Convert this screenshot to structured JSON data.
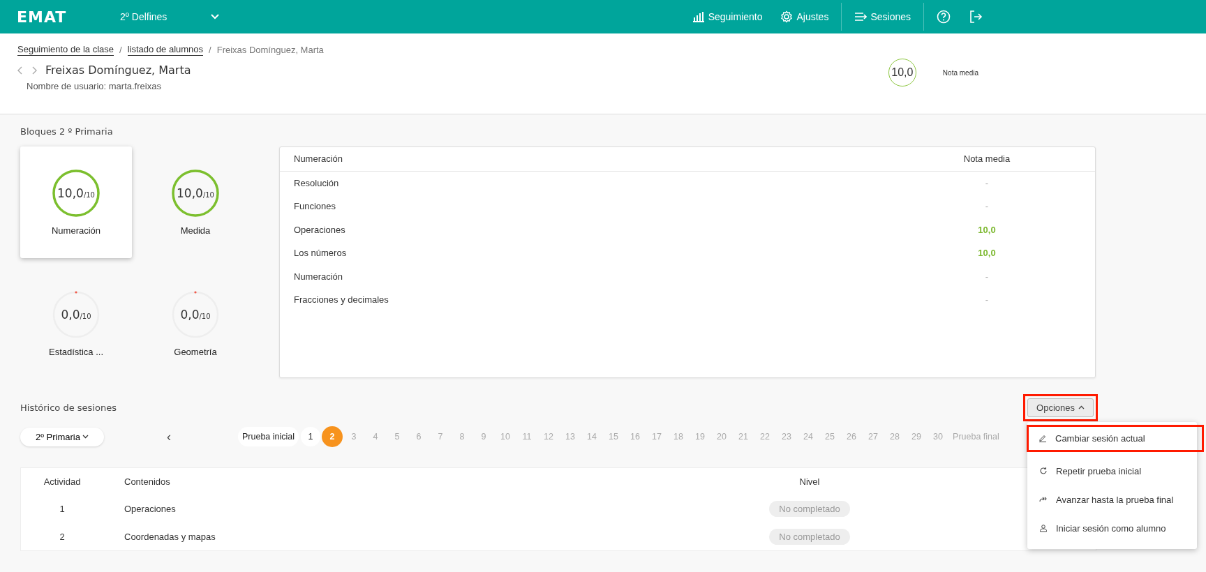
{
  "header": {
    "logo": "EMAT",
    "class_selector": "2º Delfines",
    "nav": [
      {
        "label": "Seguimiento",
        "kind": "chart"
      },
      {
        "label": "Ajustes",
        "kind": "gear"
      },
      {
        "label": "Sesiones",
        "kind": "list"
      }
    ]
  },
  "breadcrumb": [
    {
      "label": "Seguimiento de la clase",
      "kind": "link"
    },
    {
      "separator": "/",
      "label": "listado de alumnos",
      "kind": "link"
    },
    {
      "separator": "/",
      "label": "Freixas Domínguez, Marta",
      "kind": "current"
    }
  ],
  "student": {
    "name": "Freixas Domínguez, Marta",
    "username": "Nombre de usuario: marta.freixas",
    "average": "10,0",
    "average_label": "Nota media"
  },
  "blocks": {
    "title": "Bloques 2 º Primaria",
    "items": [
      {
        "name": "Numeración",
        "score": "10,0",
        "max": "/10",
        "level": 1,
        "selected": true
      },
      {
        "name": "Medida",
        "score": "10,0",
        "max": "/10",
        "level": 1,
        "selected": false
      },
      {
        "name": "Estadística ...",
        "score": "0,0",
        "max": "/10",
        "level": 0,
        "selected": false
      },
      {
        "name": "Geometría",
        "score": "0,0",
        "max": "/10",
        "level": 0,
        "selected": false
      }
    ]
  },
  "block_table": {
    "columns": [
      "Numeración",
      "Nota media"
    ],
    "rows": [
      {
        "name": "Resolución",
        "value": "-",
        "kind": "empty"
      },
      {
        "name": "Funciones",
        "value": "-",
        "kind": "empty"
      },
      {
        "name": "Operaciones",
        "value": "10,0",
        "kind": "score"
      },
      {
        "name": "Los números",
        "value": "10,0",
        "kind": "score"
      },
      {
        "name": "Numeración",
        "value": "-",
        "kind": "empty"
      },
      {
        "name": "Fracciones y decimales",
        "value": "-",
        "kind": "empty"
      }
    ]
  },
  "sessions": {
    "title": "Histórico de sesiones",
    "level_selector": "2º Primaria",
    "prev": "‹",
    "options_button": {
      "label": "Opciones",
      "highlighted": true
    },
    "pages": [
      {
        "label": "Prueba inicial",
        "kind": "done",
        "selected": false
      },
      {
        "label": "1",
        "kind": "done",
        "selected": false
      },
      {
        "label": "2",
        "kind": "current",
        "selected": true
      },
      {
        "label": "3",
        "kind": "pending",
        "selected": false
      },
      {
        "label": "4",
        "kind": "pending",
        "selected": false
      },
      {
        "label": "5",
        "kind": "pending",
        "selected": false
      },
      {
        "label": "6",
        "kind": "pending",
        "selected": false
      },
      {
        "label": "7",
        "kind": "pending",
        "selected": false
      },
      {
        "label": "8",
        "kind": "pending",
        "selected": false
      },
      {
        "label": "9",
        "kind": "pending",
        "selected": false
      },
      {
        "label": "10",
        "kind": "pending",
        "selected": false
      },
      {
        "label": "11",
        "kind": "pending",
        "selected": false
      },
      {
        "label": "12",
        "kind": "pending",
        "selected": false
      },
      {
        "label": "13",
        "kind": "pending",
        "selected": false
      },
      {
        "label": "14",
        "kind": "pending",
        "selected": false
      },
      {
        "label": "15",
        "kind": "pending",
        "selected": false
      },
      {
        "label": "16",
        "kind": "pending",
        "selected": false
      },
      {
        "label": "17",
        "kind": "pending",
        "selected": false
      },
      {
        "label": "18",
        "kind": "pending",
        "selected": false
      },
      {
        "label": "19",
        "kind": "pending",
        "selected": false
      },
      {
        "label": "20",
        "kind": "pending",
        "selected": false
      },
      {
        "label": "21",
        "kind": "pending",
        "selected": false
      },
      {
        "label": "22",
        "kind": "pending",
        "selected": false
      },
      {
        "label": "23",
        "kind": "pending",
        "selected": false
      },
      {
        "label": "24",
        "kind": "pending",
        "selected": false
      },
      {
        "label": "25",
        "kind": "pending",
        "selected": false
      },
      {
        "label": "26",
        "kind": "pending",
        "selected": false
      },
      {
        "label": "27",
        "kind": "pending",
        "selected": false
      },
      {
        "label": "28",
        "kind": "pending",
        "selected": false
      },
      {
        "label": "29",
        "kind": "pending",
        "selected": false
      },
      {
        "label": "30",
        "kind": "pending",
        "selected": false
      },
      {
        "label": "Prueba final",
        "kind": "pending",
        "selected": false
      }
    ]
  },
  "options_menu": [
    {
      "label": "Cambiar sesión actual",
      "kind": "edit",
      "highlighted": true
    },
    {
      "label": "Repetir prueba inicial",
      "kind": "repeat",
      "highlighted": false
    },
    {
      "label": "Avanzar hasta la prueba final",
      "kind": "forward",
      "highlighted": false
    },
    {
      "label": "Iniciar sesión como alumno",
      "kind": "user",
      "highlighted": false
    }
  ],
  "activities": {
    "columns": [
      "Actividad",
      "Contenidos",
      "Nivel"
    ],
    "rows": [
      {
        "number": "1",
        "content": "Operaciones",
        "level_badge": "No completado"
      },
      {
        "number": "2",
        "content": "Coordenadas y mapas",
        "level_badge": "No completado"
      }
    ]
  }
}
